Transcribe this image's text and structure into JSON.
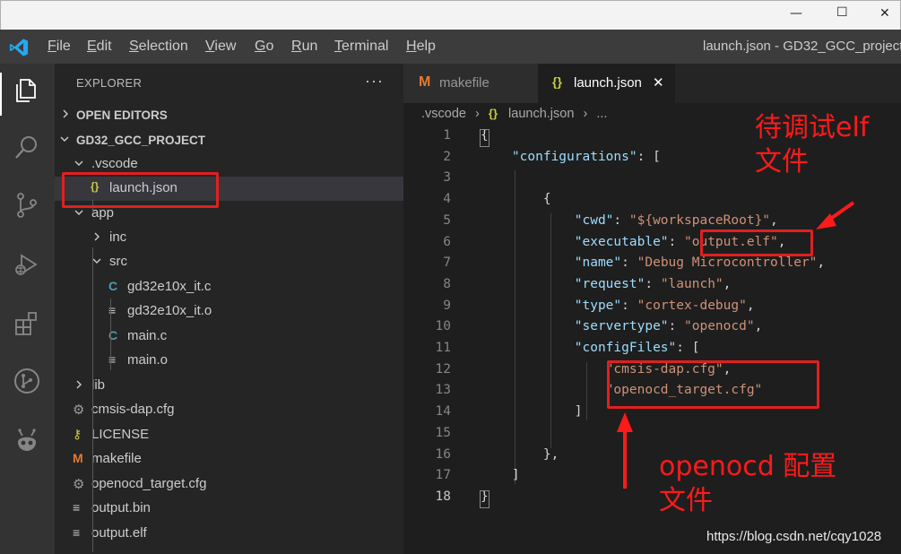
{
  "window": {
    "title": "launch.json - GD32_GCC_project -",
    "controls": {
      "minimize": "—",
      "maximize": "☐",
      "close": "✕"
    }
  },
  "menu": {
    "items": [
      {
        "pre": "",
        "ul": "F",
        "post": "ile"
      },
      {
        "pre": "",
        "ul": "E",
        "post": "dit"
      },
      {
        "pre": "",
        "ul": "S",
        "post": "election"
      },
      {
        "pre": "",
        "ul": "V",
        "post": "iew"
      },
      {
        "pre": "",
        "ul": "G",
        "post": "o"
      },
      {
        "pre": "",
        "ul": "R",
        "post": "un"
      },
      {
        "pre": "",
        "ul": "T",
        "post": "erminal"
      },
      {
        "pre": "",
        "ul": "H",
        "post": "elp"
      }
    ]
  },
  "activity_bar": {
    "icons": [
      "explorer-icon",
      "search-icon",
      "source-control-icon",
      "run-debug-icon",
      "extensions-icon",
      "git-graph-icon",
      "platformio-icon"
    ]
  },
  "explorer": {
    "title": "EXPLORER",
    "more": "···",
    "open_editors": "OPEN EDITORS",
    "project": "GD32_GCC_PROJECT",
    "tree": [
      {
        "label": ".vscode",
        "type": "folder",
        "open": true
      },
      {
        "label": "launch.json",
        "type": "json",
        "icon": "{}"
      },
      {
        "label": "app",
        "type": "folder",
        "open": true
      },
      {
        "label": "inc",
        "type": "folder",
        "open": false
      },
      {
        "label": "src",
        "type": "folder",
        "open": true
      },
      {
        "label": "gd32e10x_it.c",
        "type": "c",
        "icon": "C"
      },
      {
        "label": "gd32e10x_it.o",
        "type": "obj",
        "icon": "≡"
      },
      {
        "label": "main.c",
        "type": "c",
        "icon": "C"
      },
      {
        "label": "main.o",
        "type": "obj",
        "icon": "≡"
      },
      {
        "label": "lib",
        "type": "folder",
        "open": false
      },
      {
        "label": "cmsis-dap.cfg",
        "type": "cfg",
        "icon": "⚙"
      },
      {
        "label": "LICENSE",
        "type": "license",
        "icon": "⚷"
      },
      {
        "label": "makefile",
        "type": "make",
        "icon": "M"
      },
      {
        "label": "openocd_target.cfg",
        "type": "cfg",
        "icon": "⚙"
      },
      {
        "label": "output.bin",
        "type": "obj",
        "icon": "≡"
      },
      {
        "label": "output.elf",
        "type": "obj",
        "icon": "≡"
      }
    ]
  },
  "tabs": [
    {
      "label": "makefile",
      "icon": "M",
      "active": false
    },
    {
      "label": "launch.json",
      "icon": "{}",
      "active": true,
      "close": "✕"
    }
  ],
  "breadcrumb": [
    ".vscode",
    "›",
    "{}",
    "launch.json",
    "›",
    "..."
  ],
  "editor": {
    "line_numbers": [
      "1",
      "2",
      "3",
      "4",
      "5",
      "6",
      "7",
      "8",
      "9",
      "10",
      "11",
      "12",
      "13",
      "14",
      "15",
      "16",
      "17",
      "18"
    ],
    "active_line": "18",
    "lines": [
      [
        {
          "t": "{",
          "c": "p"
        }
      ],
      [
        {
          "t": "    ",
          "c": "p"
        },
        {
          "t": "\"configurations\"",
          "c": "k"
        },
        {
          "t": ": [",
          "c": "p"
        }
      ],
      [],
      [
        {
          "t": "        {",
          "c": "p"
        }
      ],
      [
        {
          "t": "            ",
          "c": "p"
        },
        {
          "t": "\"cwd\"",
          "c": "k"
        },
        {
          "t": ": ",
          "c": "p"
        },
        {
          "t": "\"${workspaceRoot}\"",
          "c": "s"
        },
        {
          "t": ",",
          "c": "p"
        }
      ],
      [
        {
          "t": "            ",
          "c": "p"
        },
        {
          "t": "\"executable\"",
          "c": "k"
        },
        {
          "t": ": ",
          "c": "p"
        },
        {
          "t": "\"output.elf\"",
          "c": "s"
        },
        {
          "t": ",",
          "c": "p"
        }
      ],
      [
        {
          "t": "            ",
          "c": "p"
        },
        {
          "t": "\"name\"",
          "c": "k"
        },
        {
          "t": ": ",
          "c": "p"
        },
        {
          "t": "\"Debug Microcontroller\"",
          "c": "s"
        },
        {
          "t": ",",
          "c": "p"
        }
      ],
      [
        {
          "t": "            ",
          "c": "p"
        },
        {
          "t": "\"request\"",
          "c": "k"
        },
        {
          "t": ": ",
          "c": "p"
        },
        {
          "t": "\"launch\"",
          "c": "s"
        },
        {
          "t": ",",
          "c": "p"
        }
      ],
      [
        {
          "t": "            ",
          "c": "p"
        },
        {
          "t": "\"type\"",
          "c": "k"
        },
        {
          "t": ": ",
          "c": "p"
        },
        {
          "t": "\"cortex-debug\"",
          "c": "s"
        },
        {
          "t": ",",
          "c": "p"
        }
      ],
      [
        {
          "t": "            ",
          "c": "p"
        },
        {
          "t": "\"servertype\"",
          "c": "k"
        },
        {
          "t": ": ",
          "c": "p"
        },
        {
          "t": "\"openocd\"",
          "c": "s"
        },
        {
          "t": ",",
          "c": "p"
        }
      ],
      [
        {
          "t": "            ",
          "c": "p"
        },
        {
          "t": "\"configFiles\"",
          "c": "k"
        },
        {
          "t": ": [",
          "c": "p"
        }
      ],
      [
        {
          "t": "                ",
          "c": "p"
        },
        {
          "t": "\"cmsis-dap.cfg\"",
          "c": "s"
        },
        {
          "t": ",",
          "c": "p"
        }
      ],
      [
        {
          "t": "                ",
          "c": "p"
        },
        {
          "t": "\"openocd_target.cfg\"",
          "c": "s"
        }
      ],
      [
        {
          "t": "            ]",
          "c": "p"
        }
      ],
      [],
      [
        {
          "t": "        },",
          "c": "p"
        }
      ],
      [
        {
          "t": "    ]",
          "c": "p"
        }
      ],
      [
        {
          "t": "}",
          "c": "p"
        }
      ]
    ]
  },
  "annotations": {
    "elf_note": [
      "待调试elf",
      "文件"
    ],
    "openocd_note": [
      "openocd 配置",
      "文件"
    ],
    "watermark": "https://blog.csdn.net/cqy1028"
  },
  "colors": {
    "annotation_red": "#e02020",
    "string": "#ce9178",
    "key": "#9cdcfe",
    "folder_chevron": "#cccccc",
    "c_icon": "#519aba",
    "make_icon": "#e37933",
    "json_icon": "#cbcb41"
  }
}
